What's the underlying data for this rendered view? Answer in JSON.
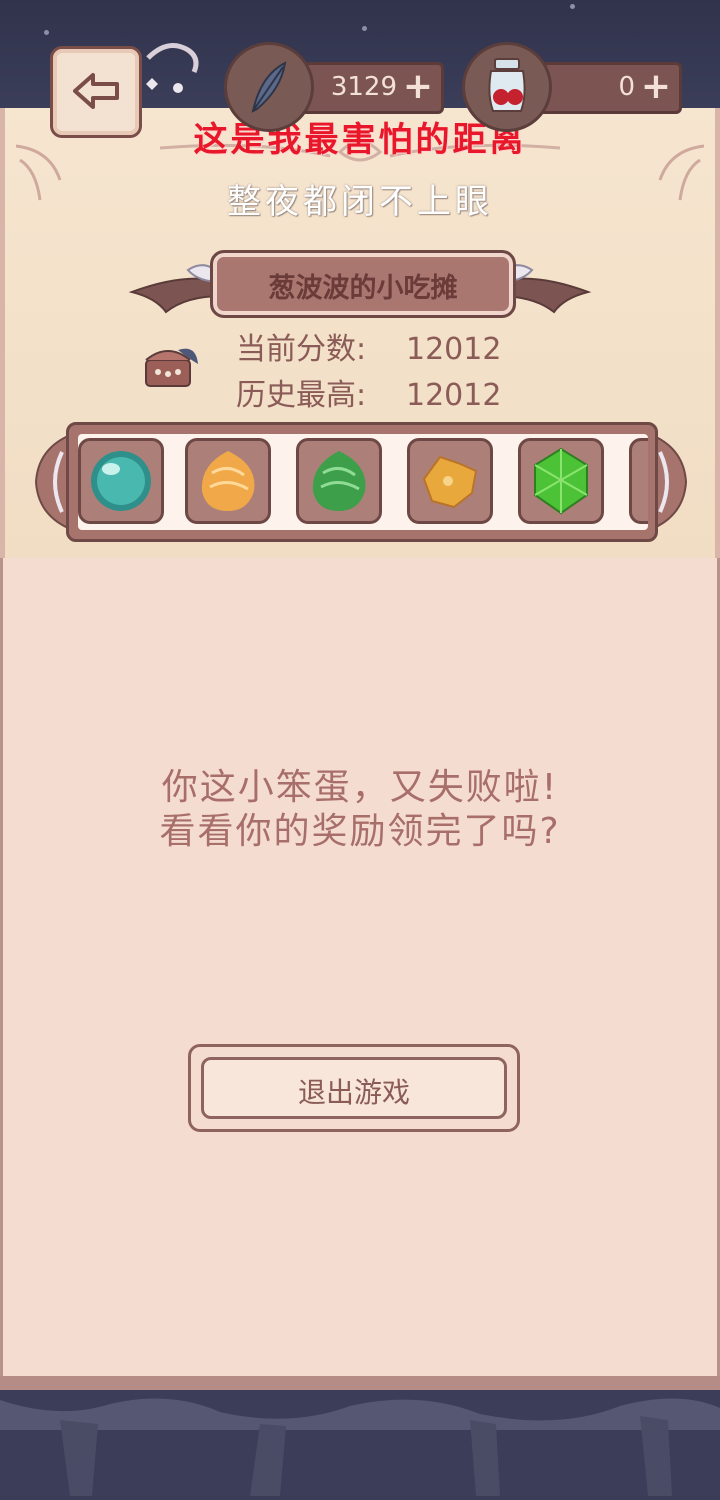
{
  "overlay": {
    "title": "这是我最害怕的距离",
    "subtitle": "整夜都闭不上眼"
  },
  "currency": {
    "feathers": {
      "icon": "feather-icon",
      "value": "3129",
      "plus": "+"
    },
    "jam": {
      "icon": "berry-jar-icon",
      "value": "0",
      "plus": "+"
    }
  },
  "stall": {
    "name": "葱波波的小吃摊",
    "current_score_label": "当前分数:",
    "current_score": "12012",
    "best_score_label": "历史最高:",
    "best_score": "12012"
  },
  "items": [
    {
      "name": "teal-orb-icon",
      "color": "#3aa9a0"
    },
    {
      "name": "orange-candy-icon",
      "color": "#f0a848"
    },
    {
      "name": "green-candy-icon",
      "color": "#3e9f4a"
    },
    {
      "name": "gold-nugget-icon",
      "color": "#e9a83c"
    },
    {
      "name": "green-gem-icon",
      "color": "#5ccf3a"
    }
  ],
  "message": {
    "line1": "你这小笨蛋，又失败啦!",
    "line2": "看看你的奖励领完了吗?"
  },
  "exit_button": {
    "label": "退出游戏"
  }
}
